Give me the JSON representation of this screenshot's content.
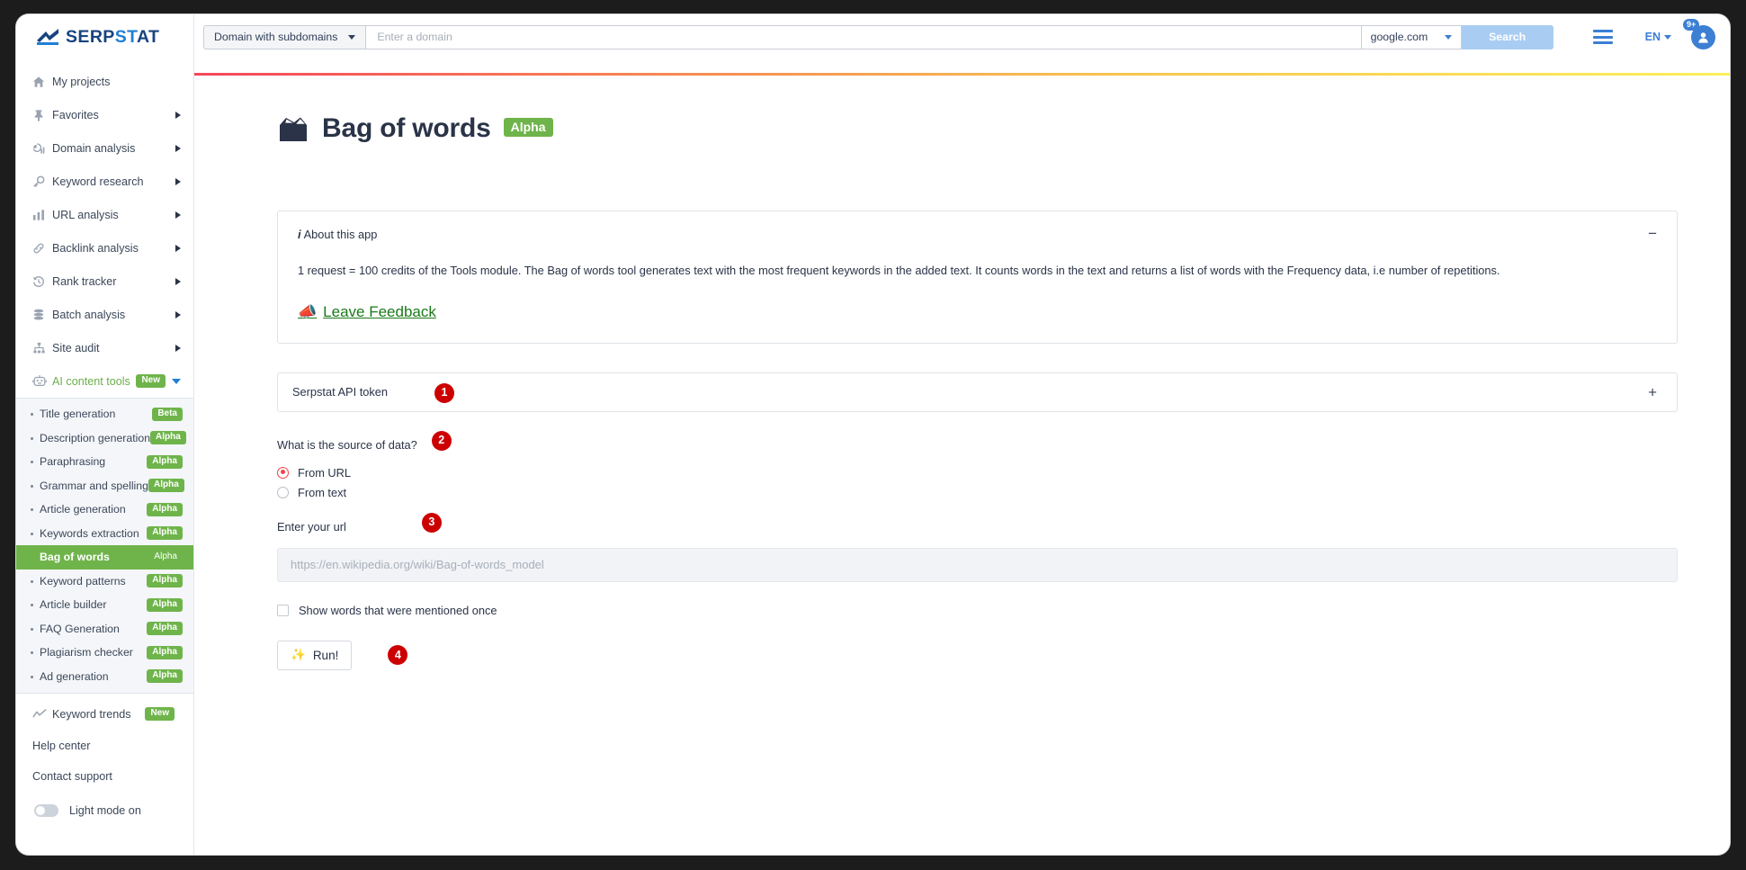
{
  "brand": {
    "name_part1": "SERP",
    "name_part2": "ST",
    "name_part3": "AT",
    "logo_icon": "serpstat-logo-icon"
  },
  "header": {
    "search_type": "Domain with subdomains",
    "domain_placeholder": "Enter a domain",
    "domain_value": "",
    "country": "google.com",
    "search_label": "Search",
    "language": "EN",
    "notification_count": "9+"
  },
  "sidebar": {
    "items": [
      {
        "label": "My projects",
        "icon": "home-icon",
        "caret": false
      },
      {
        "label": "Favorites",
        "icon": "pin-icon",
        "caret": true
      },
      {
        "label": "Domain analysis",
        "icon": "domain-chart-icon",
        "caret": true
      },
      {
        "label": "Keyword research",
        "icon": "key-icon",
        "caret": true
      },
      {
        "label": "URL analysis",
        "icon": "bar-chart-icon",
        "caret": true
      },
      {
        "label": "Backlink analysis",
        "icon": "link-icon",
        "caret": true
      },
      {
        "label": "Rank tracker",
        "icon": "history-icon",
        "caret": true
      },
      {
        "label": "Batch analysis",
        "icon": "stack-icon",
        "caret": true
      },
      {
        "label": "Site audit",
        "icon": "sitemap-icon",
        "caret": true
      }
    ],
    "ai_tools": {
      "label": "AI content tools",
      "badge": "New",
      "icon": "robot-icon"
    },
    "sub_items": [
      {
        "label": "Title generation",
        "badge": "Beta",
        "active": false
      },
      {
        "label": "Description generation",
        "badge": "Alpha",
        "active": false
      },
      {
        "label": "Paraphrasing",
        "badge": "Alpha",
        "active": false
      },
      {
        "label": "Grammar and spelling",
        "badge": "Alpha",
        "active": false
      },
      {
        "label": "Article generation",
        "badge": "Alpha",
        "active": false
      },
      {
        "label": "Keywords extraction",
        "badge": "Alpha",
        "active": false
      },
      {
        "label": "Bag of words",
        "badge": "Alpha",
        "active": true
      },
      {
        "label": "Keyword patterns",
        "badge": "Alpha",
        "active": false
      },
      {
        "label": "Article builder",
        "badge": "Alpha",
        "active": false
      },
      {
        "label": "FAQ Generation",
        "badge": "Alpha",
        "active": false
      },
      {
        "label": "Plagiarism checker",
        "badge": "Alpha",
        "active": false
      },
      {
        "label": "Ad generation",
        "badge": "Alpha",
        "active": false
      }
    ],
    "keyword_trends": {
      "label": "Keyword trends",
      "badge": "New",
      "icon": "trend-line-icon"
    },
    "help_center": "Help center",
    "contact_support": "Contact support",
    "light_mode": "Light mode on"
  },
  "page": {
    "title": "Bag of words",
    "title_badge": "Alpha",
    "title_icon": "bag-icon",
    "about": {
      "heading": "About this app",
      "info_glyph": "i",
      "text": "1 request = 100 credits of the Tools module. The Bag of words tool generates text with the most frequent keywords in the added text. It counts words in the text and returns a list of words with the Frequency data, i.e number of repetitions.",
      "feedback_label": "Leave Feedback",
      "feedback_icon": "megaphone-icon",
      "collapse_glyph": "−"
    },
    "token": {
      "label": "Serpstat API token",
      "expand_glyph": "+",
      "step": "1"
    },
    "source": {
      "label": "What is the source of data?",
      "step": "2",
      "options": [
        {
          "label": "From URL",
          "selected": true
        },
        {
          "label": "From text",
          "selected": false
        }
      ]
    },
    "url": {
      "label": "Enter your url",
      "step": "3",
      "placeholder": "https://en.wikipedia.org/wiki/Bag-of-words_model",
      "value": ""
    },
    "show_once": {
      "label": "Show words that were mentioned once",
      "checked": false
    },
    "run": {
      "label": "Run!",
      "icon": "sparkles-icon",
      "step": "4"
    }
  },
  "colors": {
    "brand_blue": "#17447e",
    "accent_blue": "#3c7fd4",
    "green": "#6fb44b",
    "red": "#f4424c",
    "step_red": "#cc0000"
  }
}
